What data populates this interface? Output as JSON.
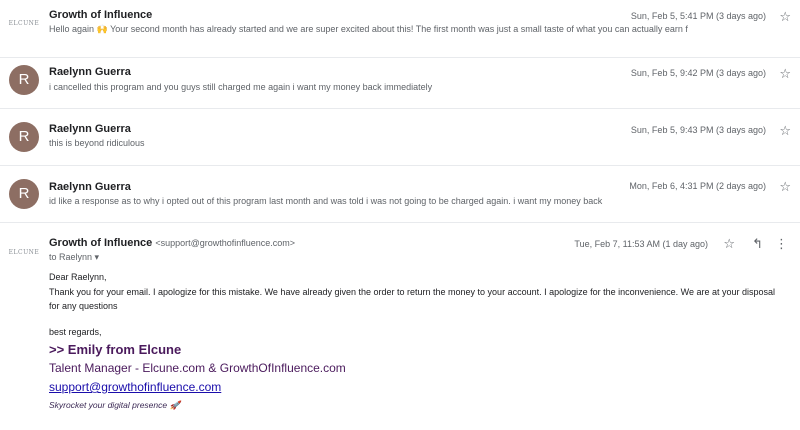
{
  "thread": [
    {
      "avatar": "ELCUNE",
      "sender": "Growth of Influence",
      "snippet": "Hello again 🙌 Your second month has already started and we are super excited about this! The first month was just a small taste of what you can actually earn f",
      "date": "Sun, Feb 5, 5:41 PM (3 days ago)"
    },
    {
      "avatar": "R",
      "sender": "Raelynn Guerra",
      "snippet": "i cancelled this program and you guys still charged me again i want my money back immediately",
      "date": "Sun, Feb 5, 9:42 PM (3 days ago)"
    },
    {
      "avatar": "R",
      "sender": "Raelynn Guerra",
      "snippet": "this is beyond ridiculous",
      "date": "Sun, Feb 5, 9:43 PM (3 days ago)"
    },
    {
      "avatar": "R",
      "sender": "Raelynn Guerra",
      "snippet": "id like a response as to why i opted out of this program last month and was told i was not going to be charged again. i want my money back",
      "date": "Mon, Feb 6, 4:31 PM (2 days ago)"
    }
  ],
  "open_message": {
    "avatar": "ELCUNE",
    "sender": "Growth of Influence",
    "sender_email": "<support@growthofinfluence.com>",
    "date": "Tue, Feb 7, 11:53 AM (1 day ago)",
    "to": "to Raelynn ▾",
    "greeting": "Dear Raelynn,",
    "body_line1": "Thank you for your email. I apologize for this mistake. We have already given the order to return the money to your account. I apologize for the inconvenience. We are at your disposal",
    "body_line2": "for any questions",
    "closing": "best regards,",
    "signature": {
      "name": ">> Emily from Elcune",
      "title": "Talent Manager - Elcune.com & GrowthOfInfluence.com",
      "email": "support@growthofinfluence.com",
      "tagline": "Skyrocket your digital presence 🚀"
    }
  },
  "icons": {
    "star": "star-icon",
    "reply": "reply-icon",
    "more": "more-vertical-icon"
  },
  "colors": {
    "avatar_bg": "#8d6e63",
    "signature_text": "#4a1a5c",
    "link": "#1a0dab"
  }
}
